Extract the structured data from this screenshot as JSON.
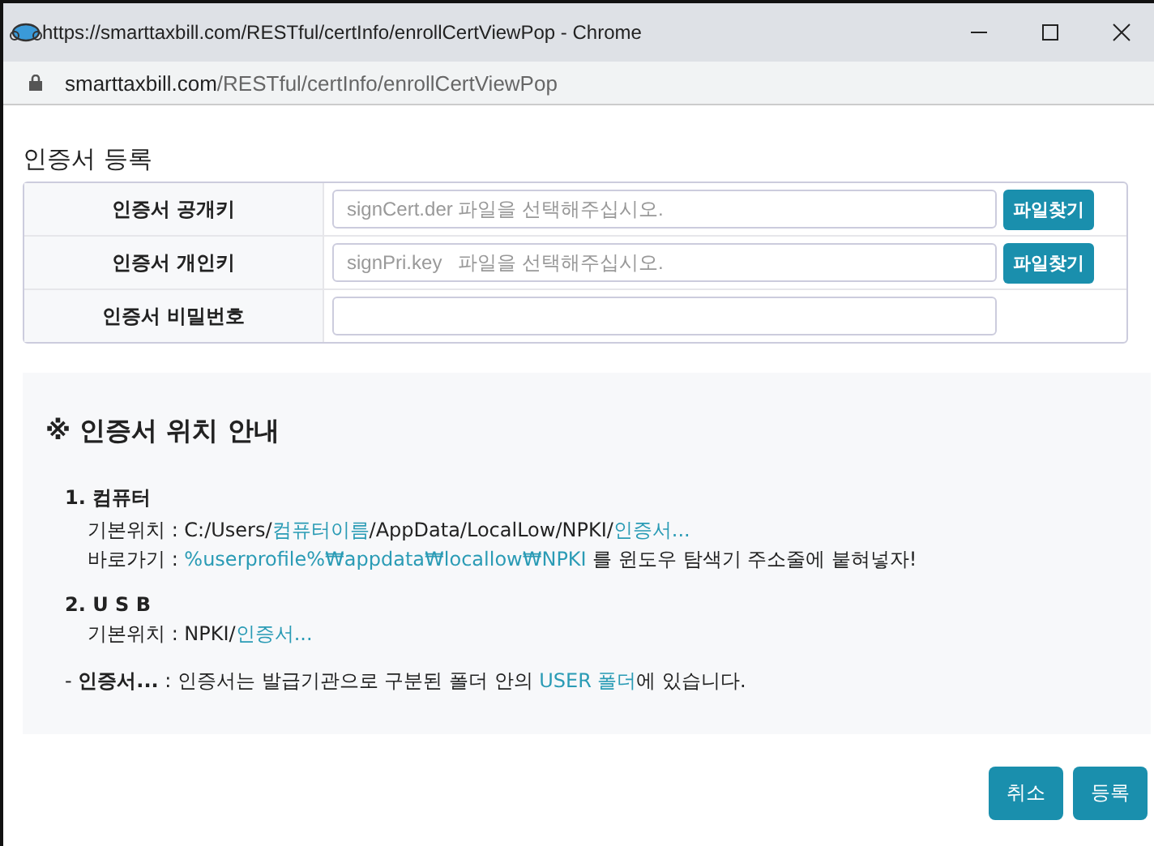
{
  "window": {
    "title": "https://smarttaxbill.com/RESTful/certInfo/enrollCertViewPop - Chrome"
  },
  "address_bar": {
    "domain": "smarttaxbill.com",
    "path": "/RESTful/certInfo/enrollCertViewPop"
  },
  "heading": "인증서 등록",
  "form_rows": [
    {
      "label": "인증서 공개키",
      "placeholder": "signCert.der 파일을 선택해주십시오.",
      "button": "파일찾기"
    },
    {
      "label": "인증서 개인키",
      "placeholder": "signPri.key   파일을 선택해주십시오.",
      "button": "파일찾기"
    },
    {
      "label": "인증서 비밀번호"
    }
  ],
  "guide": {
    "title": "※ 인증서 위치 안내",
    "sections": [
      {
        "heading": "1. 컴퓨터",
        "lines": [
          [
            {
              "text": "기본위치 : C:/Users/",
              "highlight": false
            },
            {
              "text": "컴퓨터이름",
              "highlight": true
            },
            {
              "text": "/AppData/LocalLow/NPKI/",
              "highlight": false
            },
            {
              "text": "인증서...",
              "highlight": true
            }
          ],
          [
            {
              "text": "바로가기 : ",
              "highlight": false
            },
            {
              "text": "%userprofile%₩appdata₩locallow₩NPKI",
              "highlight": true
            },
            {
              "text": " 를 윈도우 탐색기 주소줄에 붙혀넣자!",
              "highlight": false
            }
          ]
        ]
      },
      {
        "heading": "2. U S B",
        "lines": [
          [
            {
              "text": "기본위치 : NPKI/",
              "highlight": false
            },
            {
              "text": "인증서...",
              "highlight": true
            }
          ]
        ]
      }
    ],
    "note": "- **인증서...** : 인증서는 발급기관으로 구분된 폴더 안의 ",
    "note_link": "USER 폴더",
    "note_end": "에 있습니다."
  },
  "buttons": [
    "취소",
    "등록"
  ]
}
